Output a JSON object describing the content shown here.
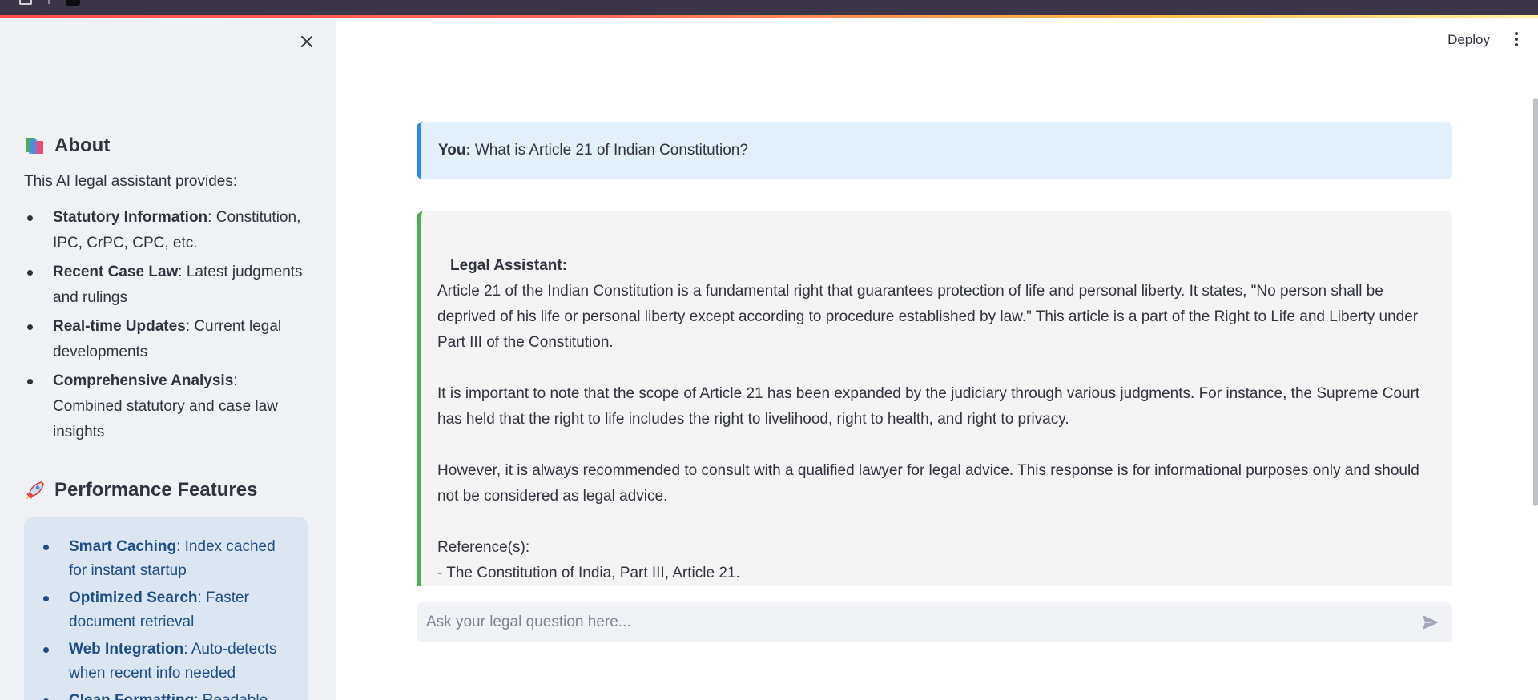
{
  "sidebar": {
    "about": {
      "heading": "About",
      "intro": "This AI legal assistant provides:",
      "items": [
        {
          "bold": "Statutory Information",
          "text": ": Constitution, IPC, CrPC, CPC, etc."
        },
        {
          "bold": "Recent Case Law",
          "text": ": Latest judgments and rulings"
        },
        {
          "bold": "Real-time Updates",
          "text": ": Current legal developments"
        },
        {
          "bold": "Comprehensive Analysis",
          "text": ": Combined statutory and case law insights"
        }
      ]
    },
    "performance": {
      "heading": "Performance Features",
      "items": [
        {
          "bold": "Smart Caching",
          "text": ": Index cached for instant startup"
        },
        {
          "bold": "Optimized Search",
          "text": ": Faster document retrieval"
        },
        {
          "bold": "Web Integration",
          "text": ": Auto-detects when recent info needed"
        },
        {
          "bold": "Clean Formatting",
          "text": ": Readable"
        }
      ]
    },
    "icons": {
      "close": "close-icon",
      "about": "books-icon",
      "performance": "rocket-icon"
    }
  },
  "header": {
    "deploy_label": "Deploy",
    "menu_icon": "kebab-menu-icon"
  },
  "chat": {
    "user": {
      "prefix": "You:",
      "text": "What is Article 21 of Indian Constitution?"
    },
    "assistant": {
      "title": "Legal Assistant:",
      "paragraphs": [
        "Article 21 of the Indian Constitution is a fundamental right that guarantees protection of life and personal liberty. It states, \"No person shall be deprived of his life or personal liberty except according to procedure established by law.\" This article is a part of the Right to Life and Liberty under Part III of the Constitution.",
        "It is important to note that the scope of Article 21 has been expanded by the judiciary through various judgments. For instance, the Supreme Court has held that the right to life includes the right to livelihood, right to health, and right to privacy.",
        "However, it is always recommended to consult with a qualified lawyer for legal advice. This response is for informational purposes only and should not be considered as legal advice.",
        "Reference(s):",
        "- The Constitution of India, Part III, Article 21."
      ]
    },
    "input": {
      "placeholder": "Ask your legal question here...",
      "value": "",
      "send_icon": "send-icon"
    }
  },
  "colors": {
    "accent": "#ff4b4b",
    "user_border": "#2c8de0",
    "assistant_border": "#4caf50",
    "sidebar_bg": "#f0f2f6",
    "perf_box_bg": "#dce6f2",
    "perf_text": "#1d4f86"
  }
}
